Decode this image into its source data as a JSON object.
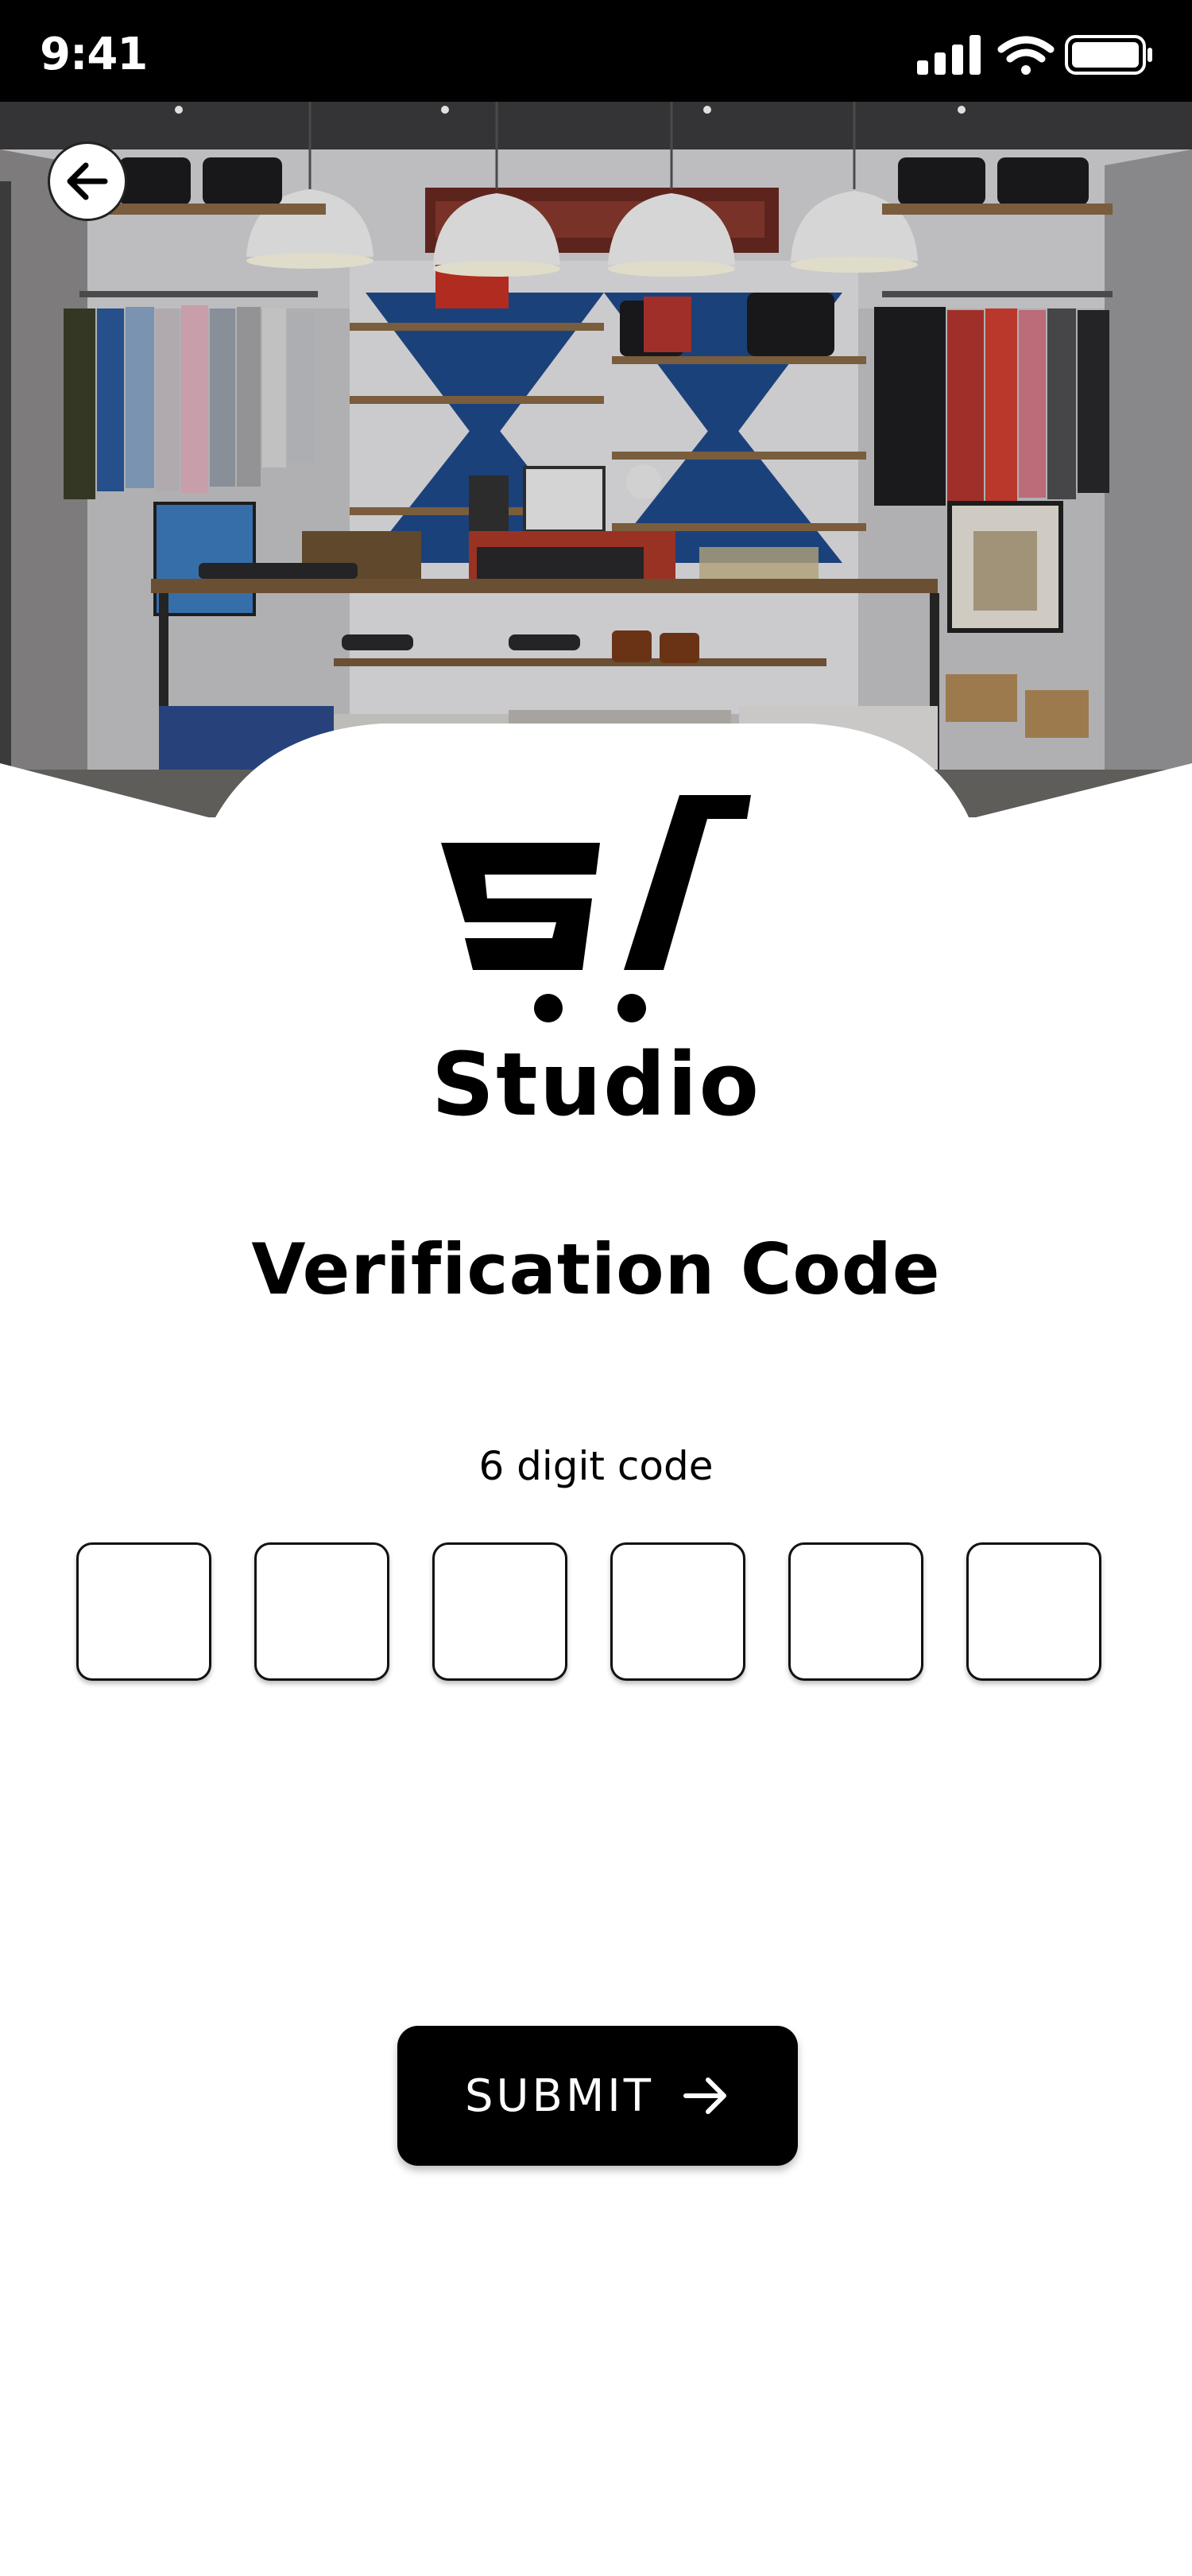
{
  "status_bar": {
    "time": "9:41",
    "icons": [
      "cellular-signal-icon",
      "wifi-icon",
      "battery-icon"
    ]
  },
  "hero": {
    "image": "clothing-store-interior-photo",
    "back_icon": "arrow-left-icon"
  },
  "brand": {
    "logo": "shopping-cart-logo",
    "name": "Studio"
  },
  "verification": {
    "title": "Verification Code",
    "code_label": "6 digit code",
    "digits": [
      "",
      "",
      "",
      "",
      "",
      ""
    ]
  },
  "submit": {
    "label": "SUBMIT",
    "icon": "arrow-right-icon"
  },
  "colors": {
    "primary": "#000000",
    "background": "#ffffff",
    "on_primary": "#ffffff"
  }
}
